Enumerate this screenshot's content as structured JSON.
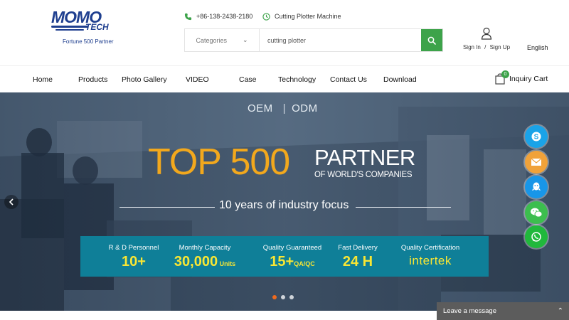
{
  "logo": {
    "brand_top": "MOMO",
    "brand_bottom": "TECH",
    "tagline": "Fortune 500 Partner"
  },
  "contact": {
    "phone": "+86-138-2438-2180",
    "product": "Cutting Plotter Machine"
  },
  "search": {
    "category_label": "Categories",
    "value": "cutting plotter"
  },
  "account": {
    "sign_in": "Sign In",
    "sep": "/",
    "sign_up": "Sign Up",
    "language": "English"
  },
  "nav": {
    "items": [
      {
        "label": "Home"
      },
      {
        "label": "Products"
      },
      {
        "label": "Photo Gallery"
      },
      {
        "label": "VIDEO"
      },
      {
        "label": "Case"
      },
      {
        "label": "Technology"
      },
      {
        "label": "Contact Us"
      },
      {
        "label": "Download"
      }
    ],
    "cart_label": "Inquiry Cart",
    "cart_count": "0"
  },
  "hero": {
    "oem": "OEM",
    "odm": "ODM",
    "headline": "TOP 500",
    "partner": "PARTNER",
    "sub": "OF WORLD'S COMPANIES",
    "tagline": "10 years of industry focus",
    "stats": [
      {
        "label": "R & D Personnel",
        "value": "10+",
        "suffix": ""
      },
      {
        "label": "Monthly Capacity",
        "value": "30,000",
        "suffix": " Units"
      },
      {
        "label": "Quality Guaranteed",
        "value": "15+",
        "suffix": "QA/QC"
      },
      {
        "label": "Fast Delivery",
        "value": "24 H",
        "suffix": ""
      },
      {
        "label": "Quality Certification",
        "value": "intertek",
        "suffix": ""
      }
    ],
    "active_slide": 1,
    "slide_count": 3
  },
  "social": [
    "skype-icon",
    "email-icon",
    "qq-icon",
    "wechat-icon",
    "whatsapp-icon"
  ],
  "colors": {
    "brand_blue": "#1f3f8f",
    "green": "#3da34a",
    "orange": "#f2a81d",
    "teal": "#0f7f98",
    "yellow": "#f8e634",
    "skype": "#1aa3e8",
    "email": "#f0a23a",
    "qq": "#1896e8",
    "wechat": "#3cbe4e",
    "whatsapp": "#20b83c"
  },
  "leave_message": "Leave a message"
}
